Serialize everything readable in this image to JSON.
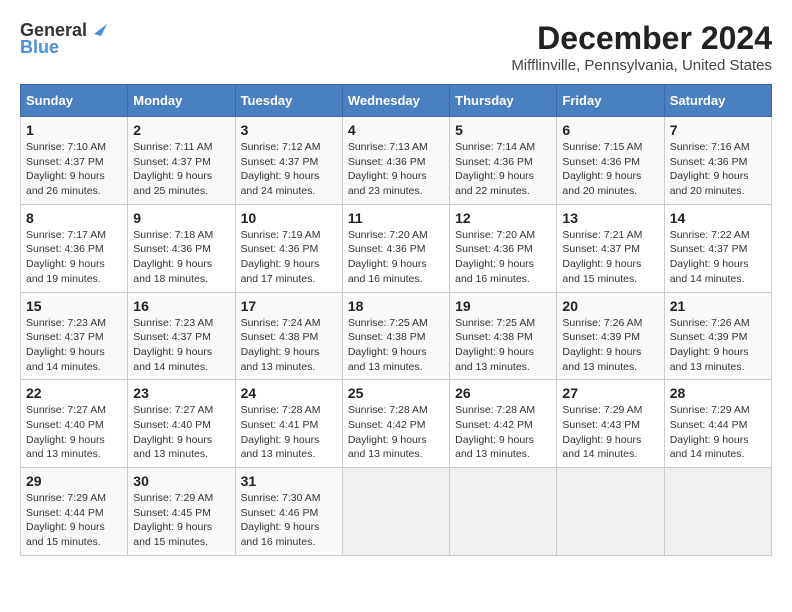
{
  "header": {
    "logo_general": "General",
    "logo_blue": "Blue",
    "month_title": "December 2024",
    "location": "Mifflinville, Pennsylvania, United States"
  },
  "calendar": {
    "days_of_week": [
      "Sunday",
      "Monday",
      "Tuesday",
      "Wednesday",
      "Thursday",
      "Friday",
      "Saturday"
    ],
    "weeks": [
      [
        {
          "day": "1",
          "sunrise": "Sunrise: 7:10 AM",
          "sunset": "Sunset: 4:37 PM",
          "daylight": "Daylight: 9 hours and 26 minutes."
        },
        {
          "day": "2",
          "sunrise": "Sunrise: 7:11 AM",
          "sunset": "Sunset: 4:37 PM",
          "daylight": "Daylight: 9 hours and 25 minutes."
        },
        {
          "day": "3",
          "sunrise": "Sunrise: 7:12 AM",
          "sunset": "Sunset: 4:37 PM",
          "daylight": "Daylight: 9 hours and 24 minutes."
        },
        {
          "day": "4",
          "sunrise": "Sunrise: 7:13 AM",
          "sunset": "Sunset: 4:36 PM",
          "daylight": "Daylight: 9 hours and 23 minutes."
        },
        {
          "day": "5",
          "sunrise": "Sunrise: 7:14 AM",
          "sunset": "Sunset: 4:36 PM",
          "daylight": "Daylight: 9 hours and 22 minutes."
        },
        {
          "day": "6",
          "sunrise": "Sunrise: 7:15 AM",
          "sunset": "Sunset: 4:36 PM",
          "daylight": "Daylight: 9 hours and 20 minutes."
        },
        {
          "day": "7",
          "sunrise": "Sunrise: 7:16 AM",
          "sunset": "Sunset: 4:36 PM",
          "daylight": "Daylight: 9 hours and 20 minutes."
        }
      ],
      [
        {
          "day": "8",
          "sunrise": "Sunrise: 7:17 AM",
          "sunset": "Sunset: 4:36 PM",
          "daylight": "Daylight: 9 hours and 19 minutes."
        },
        {
          "day": "9",
          "sunrise": "Sunrise: 7:18 AM",
          "sunset": "Sunset: 4:36 PM",
          "daylight": "Daylight: 9 hours and 18 minutes."
        },
        {
          "day": "10",
          "sunrise": "Sunrise: 7:19 AM",
          "sunset": "Sunset: 4:36 PM",
          "daylight": "Daylight: 9 hours and 17 minutes."
        },
        {
          "day": "11",
          "sunrise": "Sunrise: 7:20 AM",
          "sunset": "Sunset: 4:36 PM",
          "daylight": "Daylight: 9 hours and 16 minutes."
        },
        {
          "day": "12",
          "sunrise": "Sunrise: 7:20 AM",
          "sunset": "Sunset: 4:36 PM",
          "daylight": "Daylight: 9 hours and 16 minutes."
        },
        {
          "day": "13",
          "sunrise": "Sunrise: 7:21 AM",
          "sunset": "Sunset: 4:37 PM",
          "daylight": "Daylight: 9 hours and 15 minutes."
        },
        {
          "day": "14",
          "sunrise": "Sunrise: 7:22 AM",
          "sunset": "Sunset: 4:37 PM",
          "daylight": "Daylight: 9 hours and 14 minutes."
        }
      ],
      [
        {
          "day": "15",
          "sunrise": "Sunrise: 7:23 AM",
          "sunset": "Sunset: 4:37 PM",
          "daylight": "Daylight: 9 hours and 14 minutes."
        },
        {
          "day": "16",
          "sunrise": "Sunrise: 7:23 AM",
          "sunset": "Sunset: 4:37 PM",
          "daylight": "Daylight: 9 hours and 14 minutes."
        },
        {
          "day": "17",
          "sunrise": "Sunrise: 7:24 AM",
          "sunset": "Sunset: 4:38 PM",
          "daylight": "Daylight: 9 hours and 13 minutes."
        },
        {
          "day": "18",
          "sunrise": "Sunrise: 7:25 AM",
          "sunset": "Sunset: 4:38 PM",
          "daylight": "Daylight: 9 hours and 13 minutes."
        },
        {
          "day": "19",
          "sunrise": "Sunrise: 7:25 AM",
          "sunset": "Sunset: 4:38 PM",
          "daylight": "Daylight: 9 hours and 13 minutes."
        },
        {
          "day": "20",
          "sunrise": "Sunrise: 7:26 AM",
          "sunset": "Sunset: 4:39 PM",
          "daylight": "Daylight: 9 hours and 13 minutes."
        },
        {
          "day": "21",
          "sunrise": "Sunrise: 7:26 AM",
          "sunset": "Sunset: 4:39 PM",
          "daylight": "Daylight: 9 hours and 13 minutes."
        }
      ],
      [
        {
          "day": "22",
          "sunrise": "Sunrise: 7:27 AM",
          "sunset": "Sunset: 4:40 PM",
          "daylight": "Daylight: 9 hours and 13 minutes."
        },
        {
          "day": "23",
          "sunrise": "Sunrise: 7:27 AM",
          "sunset": "Sunset: 4:40 PM",
          "daylight": "Daylight: 9 hours and 13 minutes."
        },
        {
          "day": "24",
          "sunrise": "Sunrise: 7:28 AM",
          "sunset": "Sunset: 4:41 PM",
          "daylight": "Daylight: 9 hours and 13 minutes."
        },
        {
          "day": "25",
          "sunrise": "Sunrise: 7:28 AM",
          "sunset": "Sunset: 4:42 PM",
          "daylight": "Daylight: 9 hours and 13 minutes."
        },
        {
          "day": "26",
          "sunrise": "Sunrise: 7:28 AM",
          "sunset": "Sunset: 4:42 PM",
          "daylight": "Daylight: 9 hours and 13 minutes."
        },
        {
          "day": "27",
          "sunrise": "Sunrise: 7:29 AM",
          "sunset": "Sunset: 4:43 PM",
          "daylight": "Daylight: 9 hours and 14 minutes."
        },
        {
          "day": "28",
          "sunrise": "Sunrise: 7:29 AM",
          "sunset": "Sunset: 4:44 PM",
          "daylight": "Daylight: 9 hours and 14 minutes."
        }
      ],
      [
        {
          "day": "29",
          "sunrise": "Sunrise: 7:29 AM",
          "sunset": "Sunset: 4:44 PM",
          "daylight": "Daylight: 9 hours and 15 minutes."
        },
        {
          "day": "30",
          "sunrise": "Sunrise: 7:29 AM",
          "sunset": "Sunset: 4:45 PM",
          "daylight": "Daylight: 9 hours and 15 minutes."
        },
        {
          "day": "31",
          "sunrise": "Sunrise: 7:30 AM",
          "sunset": "Sunset: 4:46 PM",
          "daylight": "Daylight: 9 hours and 16 minutes."
        },
        null,
        null,
        null,
        null
      ]
    ]
  }
}
